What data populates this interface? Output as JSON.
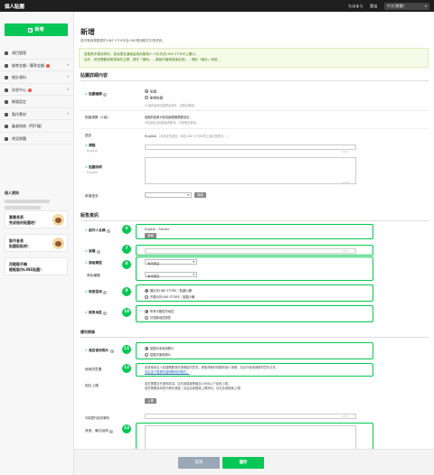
{
  "topbar": {
    "brand": "個人貼圖",
    "user": "たはまら",
    "logout": "登出",
    "language": "中文(繁體)"
  },
  "sidebar": {
    "new_button": "新增",
    "menu": [
      {
        "label": "項目管理",
        "icon": "gear-icon",
        "badge": "",
        "caret": false
      },
      {
        "label": "販售金額／匯款金額",
        "icon": "yen-icon",
        "badge": "!",
        "caret": true
      },
      {
        "label": "統計資料",
        "icon": "chart-icon",
        "badge": "",
        "caret": true
      },
      {
        "label": "訊息中心",
        "icon": "mail-icon",
        "badge": "!",
        "caret": true
      },
      {
        "label": "帳號設定",
        "icon": "user-icon",
        "badge": "",
        "caret": false
      },
      {
        "label": "製作素材",
        "icon": "pencil-icon",
        "badge": "",
        "caret": true
      },
      {
        "label": "審查指南（PDF檔）",
        "icon": "book-icon",
        "badge": "",
        "caret": false
      },
      {
        "label": "常見問題",
        "icon": "help-icon",
        "badge": "",
        "caret": false
      }
    ],
    "section_title": "個人資訊",
    "promos": [
      {
        "line1": "寶寶長表",
        "line2": "完成後的貼圖吧！"
      },
      {
        "line1": "製作者長",
        "line2": "貼圖貼貼吧！"
      },
      {
        "line1": "用輕鬆手機",
        "line2": "輕鬆製作LINE貼圖！"
      }
    ]
  },
  "page": {
    "title": "新增",
    "subtitle": "若可登填寫販賣於LINE STORE及LINE應用程式中的資訊。",
    "notice_line1": "若販賣本登錄資料，各地搜名通道皆將依最長2～3天內在LINE STORE上顯示。",
    "notice_line2": "此外，若您需要將發表後的主題，請先「重新」，顧客於審核頁面反映」，請接「儲存」按鈕。"
  },
  "details": {
    "section_title": "貼圖詳細內容",
    "type_label": "貼圖種類",
    "type_options": [
      "貼圖",
      "動態貼圖"
    ],
    "type_note": "※ 儲存後無法變更此資料，請務必確認。",
    "count_label": "貼圖張數（1組）",
    "count_note_1": "貼圖的張數可依貼圖規格需要設定。",
    "count_note_2": "※若設定全貼圖後再新增，可變更此數量。",
    "language_label": "語言",
    "language_value": "English",
    "language_note": "（本設定的語言，將在LINE STORE的上顯示發表可。）",
    "title_label": "標題",
    "title_sub": "English",
    "title_count": "0/40",
    "desc_label": "貼圖說明",
    "desc_sub": "English",
    "desc_count": "0/160",
    "add_lang_label": "新增語言",
    "add_lang_select": "-",
    "add_lang_button": "新增"
  },
  "sales": {
    "section_title": "販售資訊",
    "creator_label": "創作人名稱",
    "creator_value": "English : Sticker",
    "creator_button": "新增",
    "copyright_label": "版權",
    "copyright_count": "0/50",
    "category_label": "風格類型",
    "category_select": "尚未設定",
    "character_label": "角色種類",
    "character_select": "尚未設定",
    "area_label": "販售區域",
    "area_options": [
      "顯示於LINE STORE／貼圖小舖",
      "不顯示於LINE STORE／貼圖小舖"
    ],
    "price_label": "販售地區",
    "price_options": [
      "所有可販售的地區",
      "於選取地區販售"
    ],
    "badges": [
      "6",
      "7",
      "8",
      "9",
      "10"
    ]
  },
  "other": {
    "section_title": "權利詞條",
    "ai_label": "是否使用照片",
    "ai_options": [
      "貼圖中未使用照片",
      "貼圖中使用照片"
    ],
    "proof_label": "使用同意書",
    "proof_line1": "若是使用名人貼圖需要提供授權給同意書，應取得屬於相關的個人授權，請另外使用授權同意的文件。",
    "proof_link": "請由這下載權利證明範例的格式。",
    "upload_label": "相互上傳",
    "upload_line1": "若您需要另外證明事項，請先將檔案壓縮至10MB以下後再上傳。",
    "upload_line2": "若您需要使用當作權利憑證，請由此將檔案上傳資料，請在此將檔案上傳。",
    "upload_button": "上傳",
    "upload_count": "0/50",
    "copyright_holder_label": "可能是作品的權利",
    "copyright_holder_count": "0/50",
    "memo_label": "其他、備忘說明",
    "memo_count": "0/1000",
    "badges": [
      "11",
      "12",
      "13"
    ]
  },
  "footer": {
    "cancel": "取消",
    "save": "儲存"
  },
  "colors": {
    "accent": "#06c755",
    "topbar": "#1e1e1e"
  }
}
